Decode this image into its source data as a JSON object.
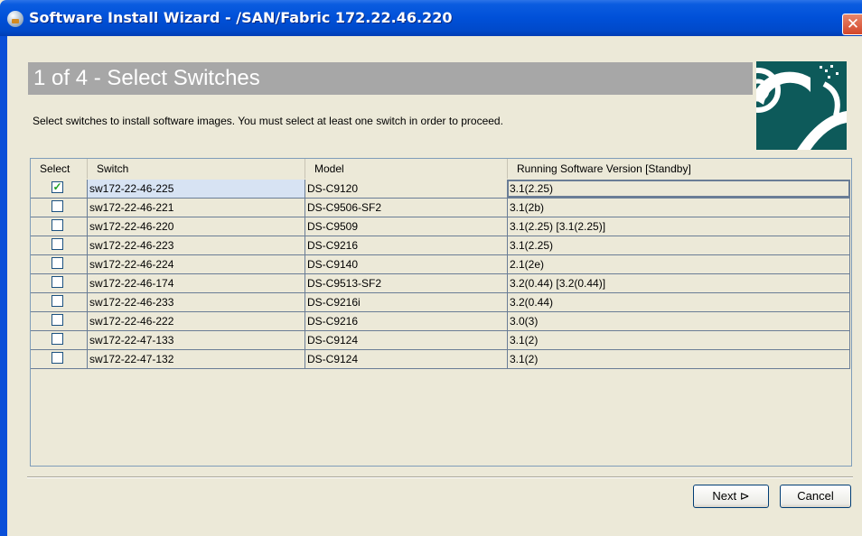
{
  "window": {
    "title": "Software Install Wizard - /SAN/Fabric 172.22.46.220",
    "close_icon": "✕"
  },
  "wizard": {
    "step_title": "1 of 4 - Select Switches",
    "instructions": "Select switches to install software images. You must select at least one switch in order to proceed."
  },
  "table": {
    "headers": {
      "select": "Select",
      "switch": "Switch",
      "model": "Model",
      "version": "Running Software Version [Standby]"
    },
    "rows": [
      {
        "checked": true,
        "switch": "sw172-22-46-225",
        "model": "DS-C9120",
        "version": "3.1(2.25)"
      },
      {
        "checked": false,
        "switch": "sw172-22-46-221",
        "model": "DS-C9506-SF2",
        "version": "3.1(2b)"
      },
      {
        "checked": false,
        "switch": "sw172-22-46-220",
        "model": "DS-C9509",
        "version": "3.1(2.25) [3.1(2.25)]"
      },
      {
        "checked": false,
        "switch": "sw172-22-46-223",
        "model": "DS-C9216",
        "version": "3.1(2.25)"
      },
      {
        "checked": false,
        "switch": "sw172-22-46-224",
        "model": "DS-C9140",
        "version": "2.1(2e)"
      },
      {
        "checked": false,
        "switch": "sw172-22-46-174",
        "model": "DS-C9513-SF2",
        "version": "3.2(0.44) [3.2(0.44)]"
      },
      {
        "checked": false,
        "switch": "sw172-22-46-233",
        "model": "DS-C9216i",
        "version": "3.2(0.44)"
      },
      {
        "checked": false,
        "switch": "sw172-22-46-222",
        "model": "DS-C9216",
        "version": "3.0(3)"
      },
      {
        "checked": false,
        "switch": "sw172-22-47-133",
        "model": "DS-C9124",
        "version": "3.1(2)"
      },
      {
        "checked": false,
        "switch": "sw172-22-47-132",
        "model": "DS-C9124",
        "version": "3.1(2)"
      }
    ]
  },
  "buttons": {
    "next": "Next",
    "next_icon": "⊳",
    "cancel": "Cancel"
  },
  "colors": {
    "titlebar": "#0050d8",
    "header_bar": "#a7a7a7",
    "logo_bg": "#0d5a5a",
    "check": "#21a121"
  },
  "icons": {
    "app": "app-globe-icon",
    "close": "close-icon",
    "check": "checkmark-icon",
    "logo": "wizard-logo-icon"
  }
}
